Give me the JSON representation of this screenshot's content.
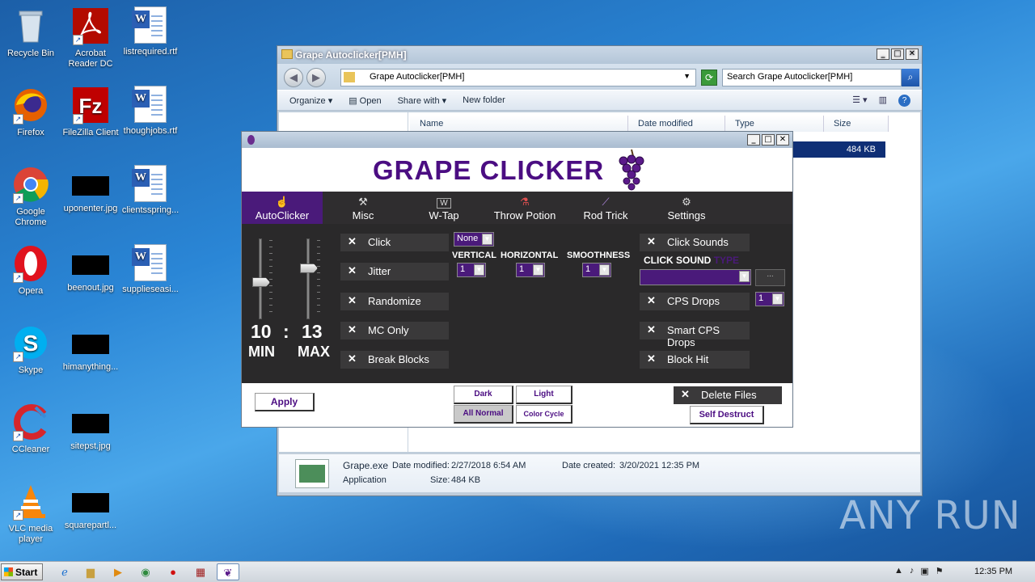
{
  "desktop": {
    "icons": [
      {
        "label": "Recycle Bin"
      },
      {
        "label": "Acrobat Reader DC"
      },
      {
        "label": "listrequired.rtf"
      },
      {
        "label": "Firefox"
      },
      {
        "label": "FileZilla Client"
      },
      {
        "label": "thoughjobs.rtf"
      },
      {
        "label": "Google Chrome"
      },
      {
        "label": "uponenter.jpg"
      },
      {
        "label": "clientsspring..."
      },
      {
        "label": "Opera"
      },
      {
        "label": "beenout.jpg"
      },
      {
        "label": "supplieseasi..."
      },
      {
        "label": "Skype"
      },
      {
        "label": "himanything..."
      },
      {
        "label": "CCleaner"
      },
      {
        "label": "sitepst.jpg"
      },
      {
        "label": "VLC media player"
      },
      {
        "label": "squarepartl..."
      }
    ],
    "watermark": "ANY RUN"
  },
  "explorer": {
    "title": "Grape Autoclicker[PMH]",
    "address": "Grape Autoclicker[PMH]",
    "search_placeholder": "Search Grape Autoclicker[PMH]",
    "toolbar": {
      "organize": "Organize ▾",
      "open": "Open",
      "share": "Share with ▾",
      "new_folder": "New folder"
    },
    "columns": {
      "name": "Name",
      "date": "Date modified",
      "type": "Type",
      "size": "Size"
    },
    "selected_size": "484 KB",
    "details": {
      "filename": "Grape.exe",
      "modified_label": "Date modified:",
      "modified": "2/27/2018 6:54 AM",
      "created_label": "Date created:",
      "created": "3/20/2021 12:35 PM",
      "type": "Application",
      "size_label": "Size:",
      "size": "484 KB"
    }
  },
  "grape": {
    "title": "GRAPE CLICKER",
    "tabs": [
      {
        "label": "AutoClicker",
        "icon": "cursor-icon"
      },
      {
        "label": "Misc",
        "icon": "wrench-icon"
      },
      {
        "label": "W-Tap",
        "icon": "w-key-icon"
      },
      {
        "label": "Throw Potion",
        "icon": "potion-icon"
      },
      {
        "label": "Rod Trick",
        "icon": "fishing-rod-icon"
      },
      {
        "label": "Settings",
        "icon": "gear-icon"
      }
    ],
    "min_value": "10",
    "separator": ":",
    "max_value": "13",
    "min_label": "MIN",
    "max_label": "MAX",
    "min_level": 0.55,
    "max_level": 0.35,
    "left_options": [
      "Click",
      "Jitter",
      "Randomize",
      "MC Only",
      "Break Blocks"
    ],
    "jitter_mode": "None",
    "vertical_label": "VERTICAL",
    "horizontal_label": "HORIZONTAL",
    "smoothness_label": "SMOOTHNESS",
    "vertical": "1",
    "horizontal": "1",
    "smoothness": "1",
    "click_sounds": "Click Sounds",
    "click_sound_label": "CLICK SOUND",
    "click_sound_type": "TYPE",
    "browse": "...",
    "cps_drops": "CPS Drops",
    "cps_drops_value": "1",
    "smart_cps_drops": "Smart CPS Drops",
    "block_hit": "Block Hit",
    "apply": "Apply",
    "dark": "Dark",
    "light": "Light",
    "all_normal": "All Normal",
    "color_cycle": "Color Cycle",
    "delete_files": "Delete Files",
    "self_destruct": "Self Destruct",
    "accent": "#4b0d82"
  },
  "taskbar": {
    "start": "Start",
    "clock": "12:35 PM"
  }
}
